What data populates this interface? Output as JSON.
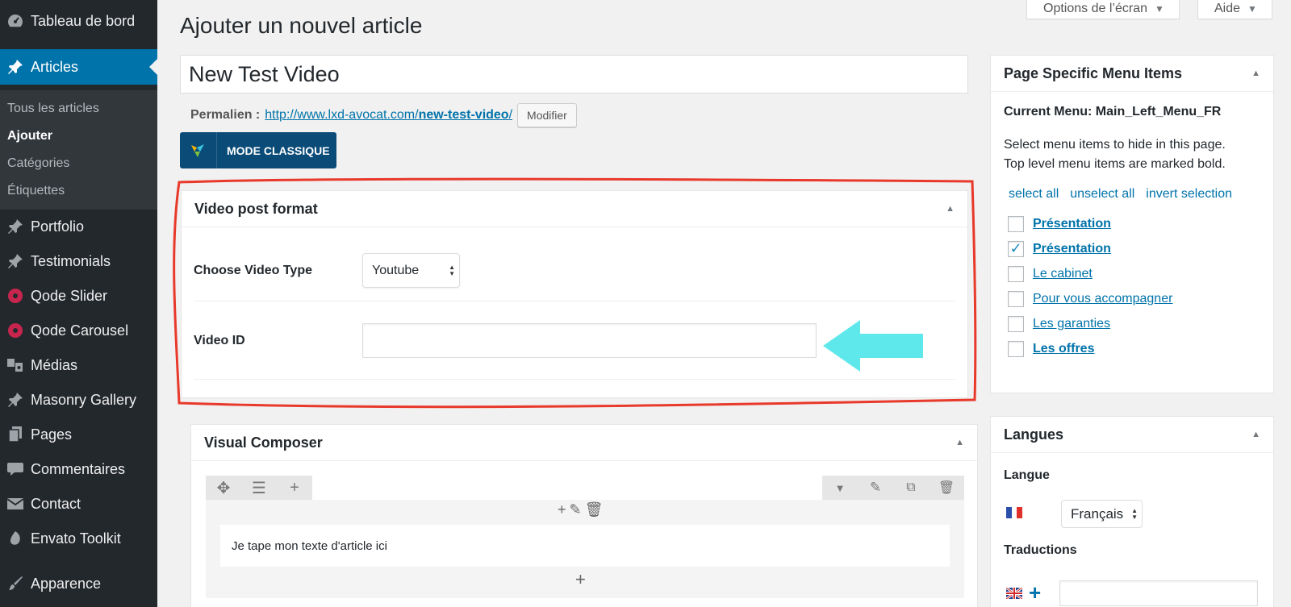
{
  "sidebar": {
    "items": [
      {
        "label": "Tableau de bord",
        "icon": "dashboard-icon"
      },
      {
        "label": "Articles",
        "icon": "pin-icon"
      },
      {
        "label": "Portfolio",
        "icon": "pin-icon"
      },
      {
        "label": "Testimonials",
        "icon": "pin-icon"
      },
      {
        "label": "Qode Slider",
        "icon": "qode-icon"
      },
      {
        "label": "Qode Carousel",
        "icon": "qode-icon"
      },
      {
        "label": "Médias",
        "icon": "media-icon"
      },
      {
        "label": "Masonry Gallery",
        "icon": "pin-icon"
      },
      {
        "label": "Pages",
        "icon": "pages-icon"
      },
      {
        "label": "Commentaires",
        "icon": "comment-icon"
      },
      {
        "label": "Contact",
        "icon": "mail-icon"
      },
      {
        "label": "Envato Toolkit",
        "icon": "leaf-icon"
      },
      {
        "label": "Apparence",
        "icon": "brush-icon"
      }
    ],
    "submenu": [
      "Tous les articles",
      "Ajouter",
      "Catégories",
      "Étiquettes"
    ]
  },
  "header": {
    "screen_options": "Options de l’écran",
    "help": "Aide",
    "title": "Ajouter un nouvel article"
  },
  "post": {
    "title_value": "New Test Video",
    "permalink_label": "Permalien :",
    "permalink_base": "http://www.lxd-avocat.com/",
    "permalink_slug": "new-test-video",
    "permalink_end": "/",
    "modify_label": "Modifier",
    "mode_classique": "MODE CLASSIQUE"
  },
  "video_box": {
    "title": "Video post format",
    "type_label": "Choose Video Type",
    "type_value": "Youtube",
    "id_label": "Video ID",
    "id_value": ""
  },
  "vc_box": {
    "title": "Visual Composer",
    "text": "Je tape mon texte d'article ici"
  },
  "psm_box": {
    "title": "Page Specific Menu Items",
    "current_menu": "Current Menu: Main_Left_Menu_FR",
    "desc_line1": "Select menu items to hide in this page.",
    "desc_line2": "Top level menu items are marked bold.",
    "links": [
      "select all",
      "unselect all",
      "invert selection"
    ],
    "items": [
      {
        "label": "Présentation",
        "bold": true,
        "checked": false
      },
      {
        "label": "Présentation",
        "bold": true,
        "checked": true
      },
      {
        "label": "Le cabinet",
        "bold": false,
        "checked": false
      },
      {
        "label": "Pour vous accompagner",
        "bold": false,
        "checked": false
      },
      {
        "label": "Les garanties",
        "bold": false,
        "checked": false
      },
      {
        "label": "Les offres",
        "bold": true,
        "checked": false
      }
    ]
  },
  "lang_box": {
    "title": "Langues",
    "langue_label": "Langue",
    "langue_value": "Français",
    "translations_label": "Traductions"
  },
  "colors": {
    "accent": "#0073aa",
    "annotation_red": "#e8392b",
    "annotation_cyan": "#5ee8ec"
  }
}
